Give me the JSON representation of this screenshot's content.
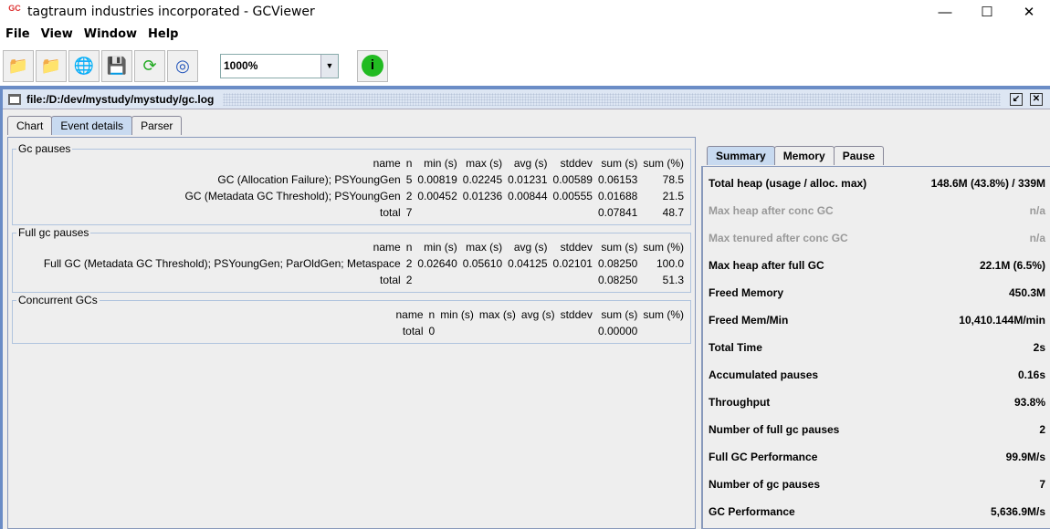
{
  "window": {
    "title": "tagtraum industries incorporated - GCViewer",
    "logo": "GC"
  },
  "menu": [
    "File",
    "View",
    "Window",
    "Help"
  ],
  "toolbar": {
    "icons": [
      "open-file-icon",
      "open-folder-icon",
      "open-url-icon",
      "save-icon",
      "refresh-icon",
      "watch-icon"
    ],
    "zoom_value": "1000%",
    "info_icon": "info-icon"
  },
  "frame": {
    "title": "file:/D:/dev/mystudy/mystudy/gc.log"
  },
  "tabs": [
    "Chart",
    "Event details",
    "Parser"
  ],
  "columns": [
    "name",
    "n",
    "min (s)",
    "max (s)",
    "avg (s)",
    "stddev",
    "sum (s)",
    "sum (%)"
  ],
  "groups": [
    {
      "title": "Gc pauses",
      "rows": [
        [
          "GC (Allocation Failure); PSYoungGen",
          "5",
          "0.00819",
          "0.02245",
          "0.01231",
          "0.00589",
          "0.06153",
          "78.5"
        ],
        [
          "GC (Metadata GC Threshold); PSYoungGen",
          "2",
          "0.00452",
          "0.01236",
          "0.00844",
          "0.00555",
          "0.01688",
          "21.5"
        ],
        [
          "total",
          "7",
          "",
          "",
          "",
          "",
          "0.07841",
          "48.7"
        ]
      ]
    },
    {
      "title": "Full gc pauses",
      "rows": [
        [
          "Full GC (Metadata GC Threshold); PSYoungGen; ParOldGen; Metaspace",
          "2",
          "0.02640",
          "0.05610",
          "0.04125",
          "0.02101",
          "0.08250",
          "100.0"
        ],
        [
          "total",
          "2",
          "",
          "",
          "",
          "",
          "0.08250",
          "51.3"
        ]
      ]
    },
    {
      "title": "Concurrent GCs",
      "rows": [
        [
          "total",
          "0",
          "",
          "",
          "",
          "",
          "0.00000",
          ""
        ]
      ]
    }
  ],
  "right_tabs": [
    "Summary",
    "Memory",
    "Pause"
  ],
  "summary": [
    {
      "label": "Total heap (usage / alloc. max)",
      "value": "148.6M (43.8%) / 339M"
    },
    {
      "label": "Max heap after conc GC",
      "value": "n/a",
      "dim": true
    },
    {
      "label": "Max tenured after conc GC",
      "value": "n/a",
      "dim": true
    },
    {
      "label": "Max heap after full GC",
      "value": "22.1M (6.5%)"
    },
    {
      "label": "Freed Memory",
      "value": "450.3M"
    },
    {
      "label": "Freed Mem/Min",
      "value": "10,410.144M/min"
    },
    {
      "label": "Total Time",
      "value": "2s"
    },
    {
      "label": "Accumulated pauses",
      "value": "0.16s"
    },
    {
      "label": "Throughput",
      "value": "93.8%"
    },
    {
      "label": "Number of full gc pauses",
      "value": "2"
    },
    {
      "label": "Full GC Performance",
      "value": "99.9M/s"
    },
    {
      "label": "Number of gc pauses",
      "value": "7"
    },
    {
      "label": "GC Performance",
      "value": "5,636.9M/s"
    }
  ]
}
